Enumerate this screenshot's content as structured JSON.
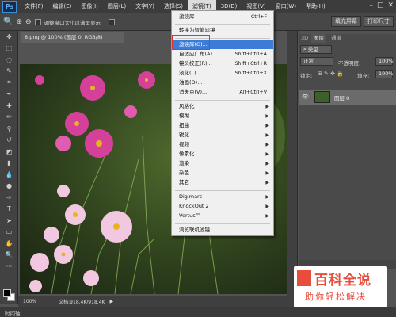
{
  "app": {
    "logo": "Ps"
  },
  "menubar": {
    "items": [
      "文件(F)",
      "编辑(E)",
      "图像(I)",
      "图层(L)",
      "文字(Y)",
      "选择(S)",
      "滤镜(T)",
      "3D(D)",
      "视图(V)",
      "窗口(W)",
      "帮助(H)"
    ]
  },
  "optionsbar": {
    "resize_windows": "调整窗口大小以满屏显示",
    "btn_fill": "填充屏幕",
    "btn_print": "打印尺寸"
  },
  "document": {
    "tab": "8.png @ 100% (图层 0, RGB/8)",
    "zoom": "100%",
    "docinfo": "文档:918.4K/918.4K"
  },
  "filter_menu": {
    "last_filter": {
      "label": "滤镜库",
      "shortcut": "Ctrl+F"
    },
    "convert_smart": "转换为智能滤镜",
    "items_group1": [
      {
        "label": "滤镜库(G)...",
        "shortcut": ""
      },
      {
        "label": "自适应广角(A)...",
        "shortcut": "Shift+Ctrl+A"
      },
      {
        "label": "镜头校正(R)...",
        "shortcut": "Shift+Ctrl+R"
      },
      {
        "label": "液化(L)...",
        "shortcut": "Shift+Ctrl+X"
      },
      {
        "label": "油画(O)...",
        "shortcut": ""
      },
      {
        "label": "消失点(V)...",
        "shortcut": "Alt+Ctrl+V"
      }
    ],
    "submenus": [
      "风格化",
      "模糊",
      "扭曲",
      "锐化",
      "视频",
      "像素化",
      "渲染",
      "杂色",
      "其它"
    ],
    "plugins": [
      "Digimarc",
      "KnockOut 2",
      "Vertus™"
    ],
    "browse_online": "浏览联机滤镜..."
  },
  "layers_panel": {
    "tabs": [
      "3D",
      "图层",
      "通道"
    ],
    "filter_type": "类型",
    "blend_mode": "正常",
    "opacity_label": "不透明度:",
    "opacity_value": "100%",
    "lock_label": "锁定:",
    "fill_label": "填充:",
    "fill_value": "100%",
    "layer_name": "图层 0"
  },
  "bottom": {
    "timeline": "时间轴"
  },
  "watermark": {
    "big": "百科全说",
    "small": "助你轻松解决"
  },
  "colors": {
    "highlight": "#3c7cd7",
    "annotation": "#e03030",
    "watermark": "#e74c3c"
  }
}
